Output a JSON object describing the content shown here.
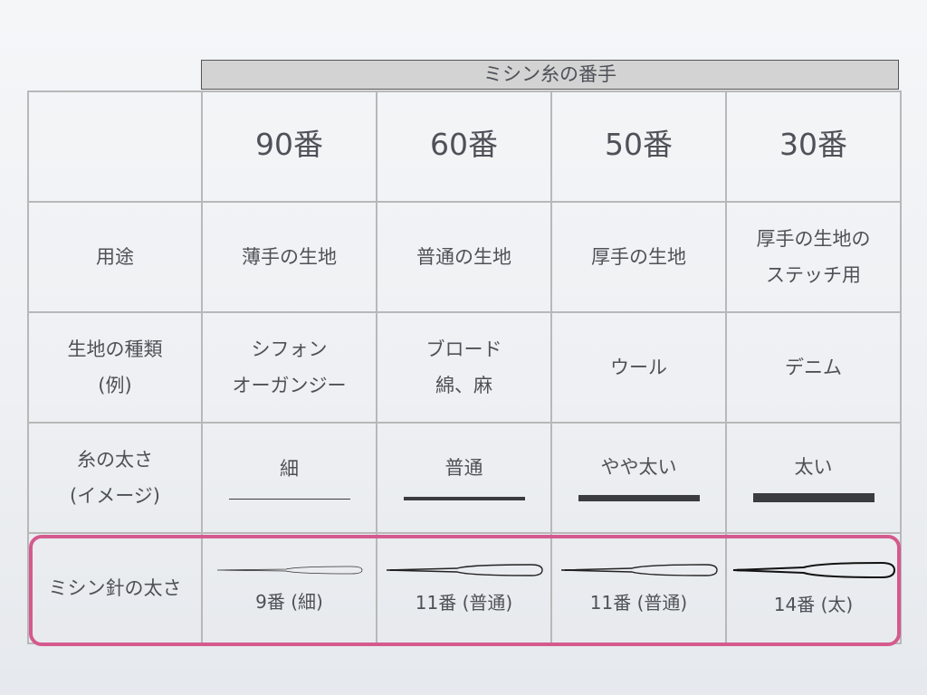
{
  "super_header": "ミシン糸の番手",
  "columns": [
    "90番",
    "60番",
    "50番",
    "30番"
  ],
  "rows": {
    "usage": {
      "label": "用途",
      "cells": [
        [
          "薄手の生地"
        ],
        [
          "普通の生地"
        ],
        [
          "厚手の生地"
        ],
        [
          "厚手の生地の",
          "ステッチ用"
        ]
      ]
    },
    "fabric": {
      "label": [
        "生地の種類",
        "(例)"
      ],
      "cells": [
        [
          "シフォン",
          "オーガンジー"
        ],
        [
          "ブロード",
          "綿、麻"
        ],
        [
          "ウール"
        ],
        [
          "デニム"
        ]
      ]
    },
    "thickness": {
      "label": [
        "糸の太さ",
        "(イメージ)"
      ],
      "cells": [
        "細",
        "普通",
        "やや太い",
        "太い"
      ],
      "line_weights": [
        1,
        4,
        7,
        10
      ]
    },
    "needle": {
      "label": "ミシン針の太さ",
      "cells": [
        "9番 (細)",
        "11番 (普通)",
        "11番 (普通)",
        "14番 (太)"
      ]
    }
  },
  "colors": {
    "highlight": "#d45a8e",
    "header_fill": "#d3d3d3",
    "grid": "#b8b8b8"
  }
}
